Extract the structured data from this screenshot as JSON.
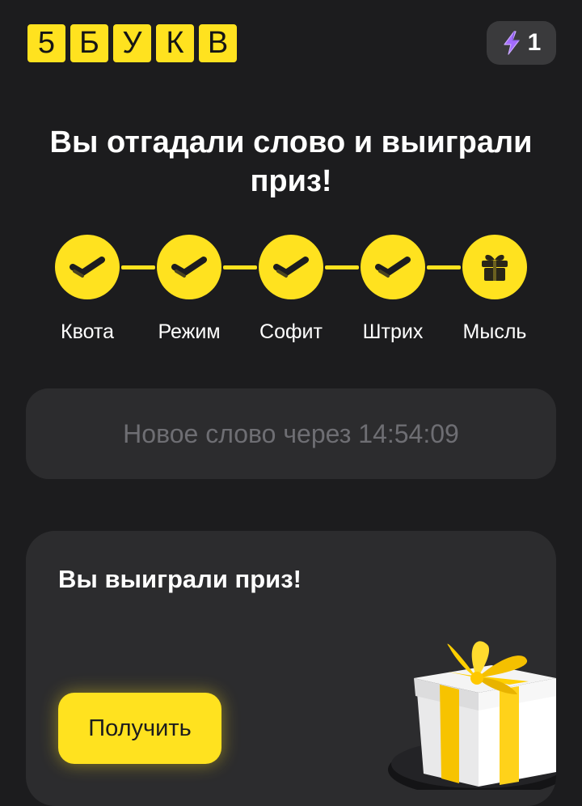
{
  "header": {
    "logo_letters": [
      "5",
      "Б",
      "У",
      "К",
      "В"
    ],
    "energy_count": "1",
    "energy_icon": "lightning-icon",
    "accent_color": "#ffe21f",
    "energy_icon_color": "#a36bff"
  },
  "title": "Вы отгадали слово и выиграли приз!",
  "progress": {
    "steps": [
      {
        "label": "Квота",
        "status": "done",
        "icon": "check-icon"
      },
      {
        "label": "Режим",
        "status": "done",
        "icon": "check-icon"
      },
      {
        "label": "Софит",
        "status": "done",
        "icon": "check-icon"
      },
      {
        "label": "Штрих",
        "status": "done",
        "icon": "check-icon"
      },
      {
        "label": "Мысль",
        "status": "prize",
        "icon": "gift-icon"
      }
    ]
  },
  "timer": {
    "text": "Новое слово через 14:54:09"
  },
  "prize": {
    "title": "Вы выиграли приз!",
    "button_label": "Получить",
    "illustration": "gift-box-illustration"
  }
}
